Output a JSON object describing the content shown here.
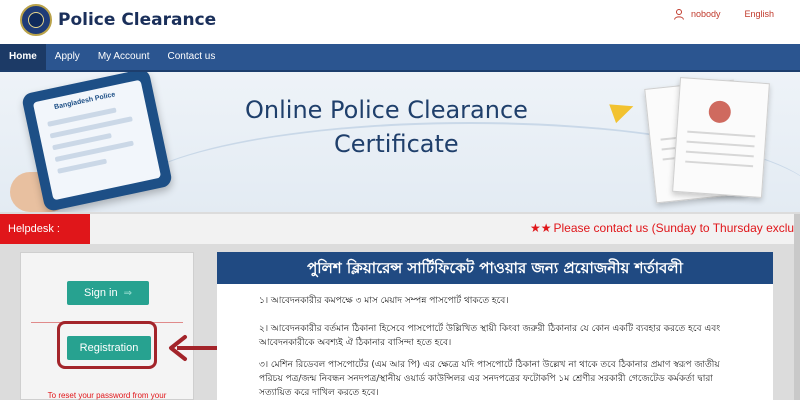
{
  "header": {
    "brand": "Police Clearance",
    "user": "nobody",
    "language": "English"
  },
  "nav": {
    "items": [
      "Home",
      "Apply",
      "My Account",
      "Contact us"
    ]
  },
  "banner": {
    "title_line1": "Online Police Clearance",
    "title_line2": "Certificate",
    "tablet_label": "Bangladesh Police"
  },
  "helpdesk": {
    "label": "Helpdesk :",
    "stars": "★★",
    "ticker": "Please contact us (Sunday to Thursday exclud"
  },
  "auth": {
    "signin_label": "Sign in",
    "signin_arrow": "⇒",
    "registration_label": "Registration",
    "reset_text": "To reset your password from your"
  },
  "requirements": {
    "heading": "পুলিশ ক্লিয়ারেন্স সার্টিফিকেট পাওয়ার জন্য প্রয়োজনীয় শর্তাবলী",
    "items": [
      "১। আবেদনকারীর কমপক্ষে ৩ মাস মেয়াদ সম্পন্ন পাসপোর্ট থাকতে হবে।",
      "২। আবেদনকারীর বর্তমান ঠিকানা হিসেবে পাসপোর্টে উল্লিখিত স্থায়ী কিংবা জরুরী ঠিকানার যে কোন একটি ব্যবহার করতে হবে এবং আবেদনকারীকে অবশ্যই ঐ ঠিকানার বাসিন্দা হতে হবে।",
      "৩। মেশিন রিডেবল পাসপোর্টের (এম আর পি) এর ক্ষেত্রে যদি পাসপোর্টে ঠিকানা উল্লেখ না থাকে তবে ঠিকানার প্রমাণ স্বরূপ জাতীয় পরিচয় পত্র/জন্ম নিবন্ধন সনদপত্র/স্থানীয় ওয়ার্ড কাউন্সিলর এর সনদপত্রের ফটোকপি ১ম শ্রেণীর সরকারী গেজেটেড কর্মকর্তা দ্বারা সত্যায়িত করে দাখিল করতে হবে।"
    ]
  },
  "colors": {
    "nav_bg": "#2b5590",
    "helpdesk_red": "#e0161a",
    "button_teal": "#27a290",
    "highlight_border": "#a3242a",
    "heading_bg": "#204a82"
  }
}
